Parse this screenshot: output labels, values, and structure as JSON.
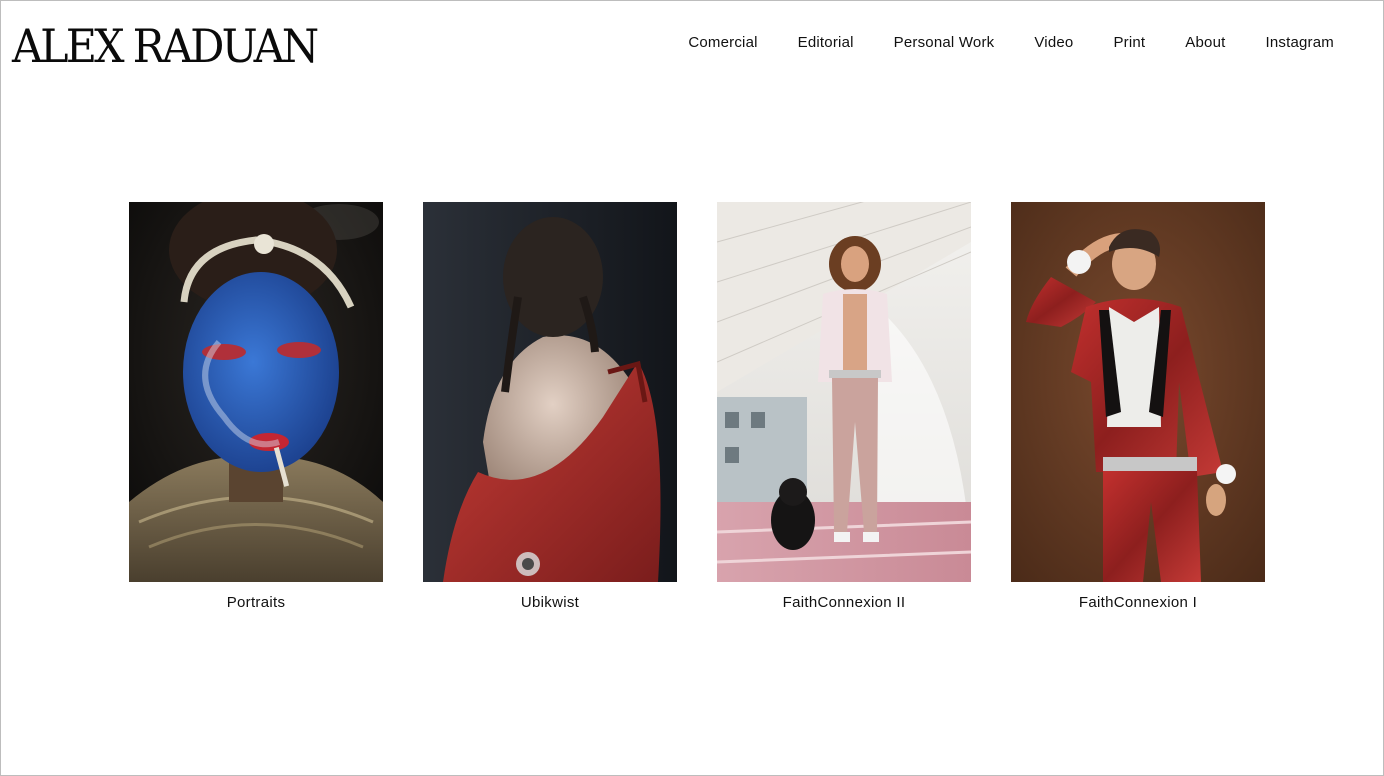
{
  "brand": {
    "logo_text": "ALEX RADUAN"
  },
  "nav": {
    "items": [
      {
        "label": "Comercial"
      },
      {
        "label": "Editorial"
      },
      {
        "label": "Personal Work"
      },
      {
        "label": "Video"
      },
      {
        "label": "Print"
      },
      {
        "label": "About"
      },
      {
        "label": "Instagram"
      }
    ]
  },
  "gallery": {
    "items": [
      {
        "caption": "Portraits",
        "image_alt": "blue-painted-face-portrait"
      },
      {
        "caption": "Ubikwist",
        "image_alt": "back-view-red-jacket-portrait"
      },
      {
        "caption": "FaithConnexion II",
        "image_alt": "man-with-black-dog-in-white-room"
      },
      {
        "caption": "FaithConnexion I",
        "image_alt": "man-in-red-metallic-suit"
      }
    ]
  },
  "colors": {
    "background": "#ffffff",
    "text": "#111111",
    "border": "#bdbdbd"
  }
}
